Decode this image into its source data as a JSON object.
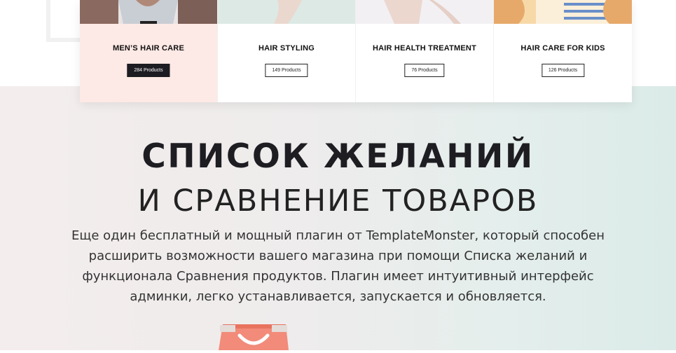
{
  "categories": [
    {
      "title": "MEN’S HAIR CARE",
      "count": "284 Products",
      "active": true
    },
    {
      "title": "HAIR STYLING",
      "count": "149 Products",
      "active": false
    },
    {
      "title": "HAIR HEALTH TREATMENT",
      "count": "76 Products",
      "active": false
    },
    {
      "title": "HAIR CARE FOR KIDS",
      "count": "126 Products",
      "active": false
    }
  ],
  "feature": {
    "heading_bold": "СПИСОК ЖЕЛАНИЙ",
    "heading_light": "И СРАВНЕНИЕ ТОВАРОВ",
    "description": "Еще один бесплатный и мощный плагин от TemplateMonster, который способен расширить возможности вашего магазина при помощи Списка желаний и функционала Сравнения продуктов. Плагин имеет интуитивный интерфейс админки, легко устанавливается, запускается и обновляется."
  },
  "icons": {
    "bag": "shopping-bag-icon"
  },
  "colors": {
    "active_card": "#fde9e5",
    "active_badge": "#1c1c22",
    "bag": "#f28b7a"
  }
}
